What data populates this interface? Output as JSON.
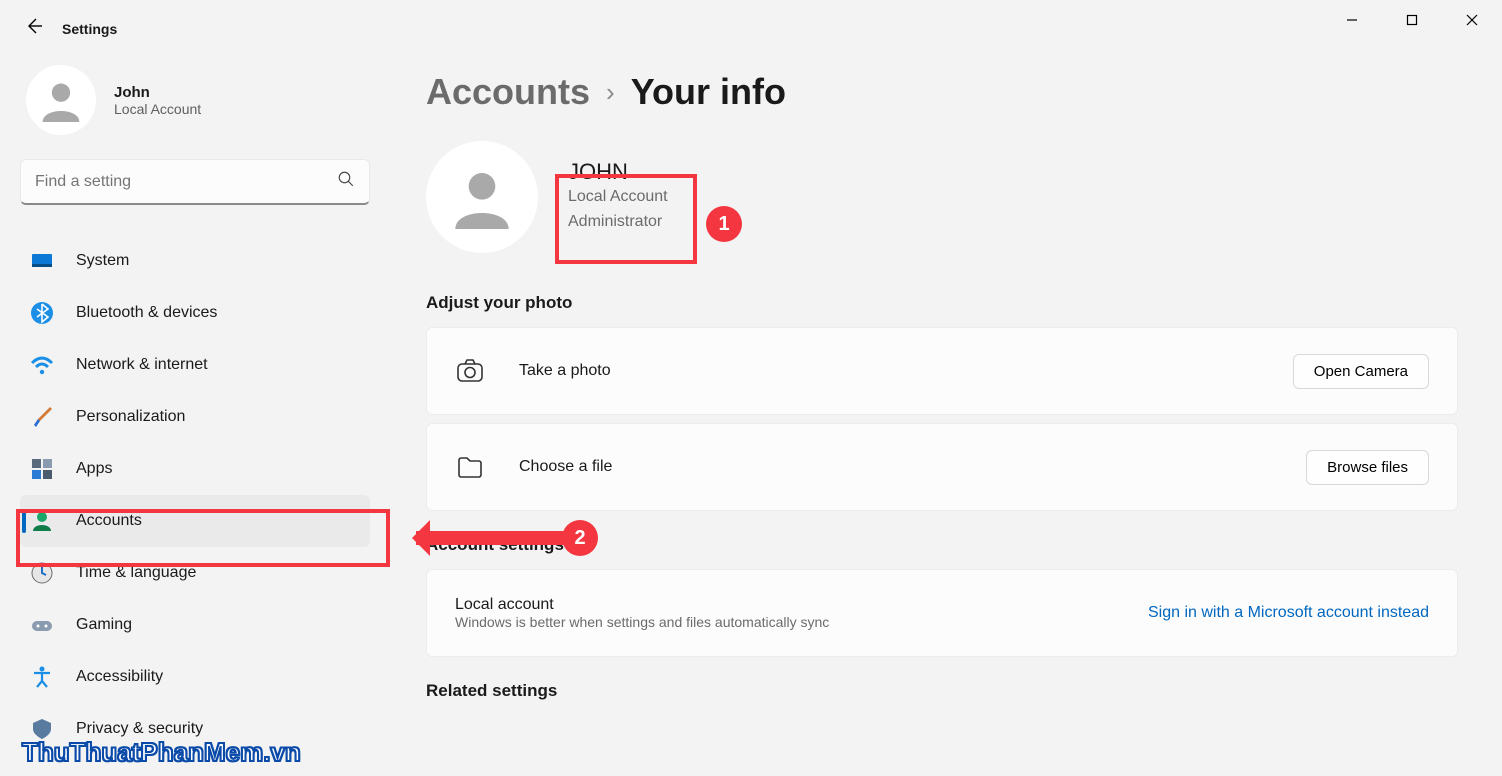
{
  "window": {
    "app_title": "Settings"
  },
  "sidebar": {
    "profile": {
      "name": "John",
      "subtitle": "Local Account"
    },
    "search_placeholder": "Find a setting",
    "items": [
      {
        "label": "System"
      },
      {
        "label": "Bluetooth & devices"
      },
      {
        "label": "Network & internet"
      },
      {
        "label": "Personalization"
      },
      {
        "label": "Apps"
      },
      {
        "label": "Accounts"
      },
      {
        "label": "Time & language"
      },
      {
        "label": "Gaming"
      },
      {
        "label": "Accessibility"
      },
      {
        "label": "Privacy & security"
      }
    ]
  },
  "breadcrumb": {
    "parent": "Accounts",
    "current": "Your info"
  },
  "your_info": {
    "name": "JOHN",
    "line1": "Local Account",
    "line2": "Administrator"
  },
  "photo_section": {
    "title": "Adjust your photo",
    "take_photo": {
      "label": "Take a photo",
      "button": "Open Camera"
    },
    "choose_file": {
      "label": "Choose a file",
      "button": "Browse files"
    }
  },
  "account_settings": {
    "title": "Account settings",
    "local": {
      "title": "Local account",
      "subtitle": "Windows is better when settings and files automatically sync",
      "action": "Sign in with a Microsoft account instead"
    }
  },
  "related": {
    "title": "Related settings"
  },
  "annotations": {
    "badge1": "1",
    "badge2": "2"
  },
  "watermark": "ThuThuatPhanMem.vn"
}
